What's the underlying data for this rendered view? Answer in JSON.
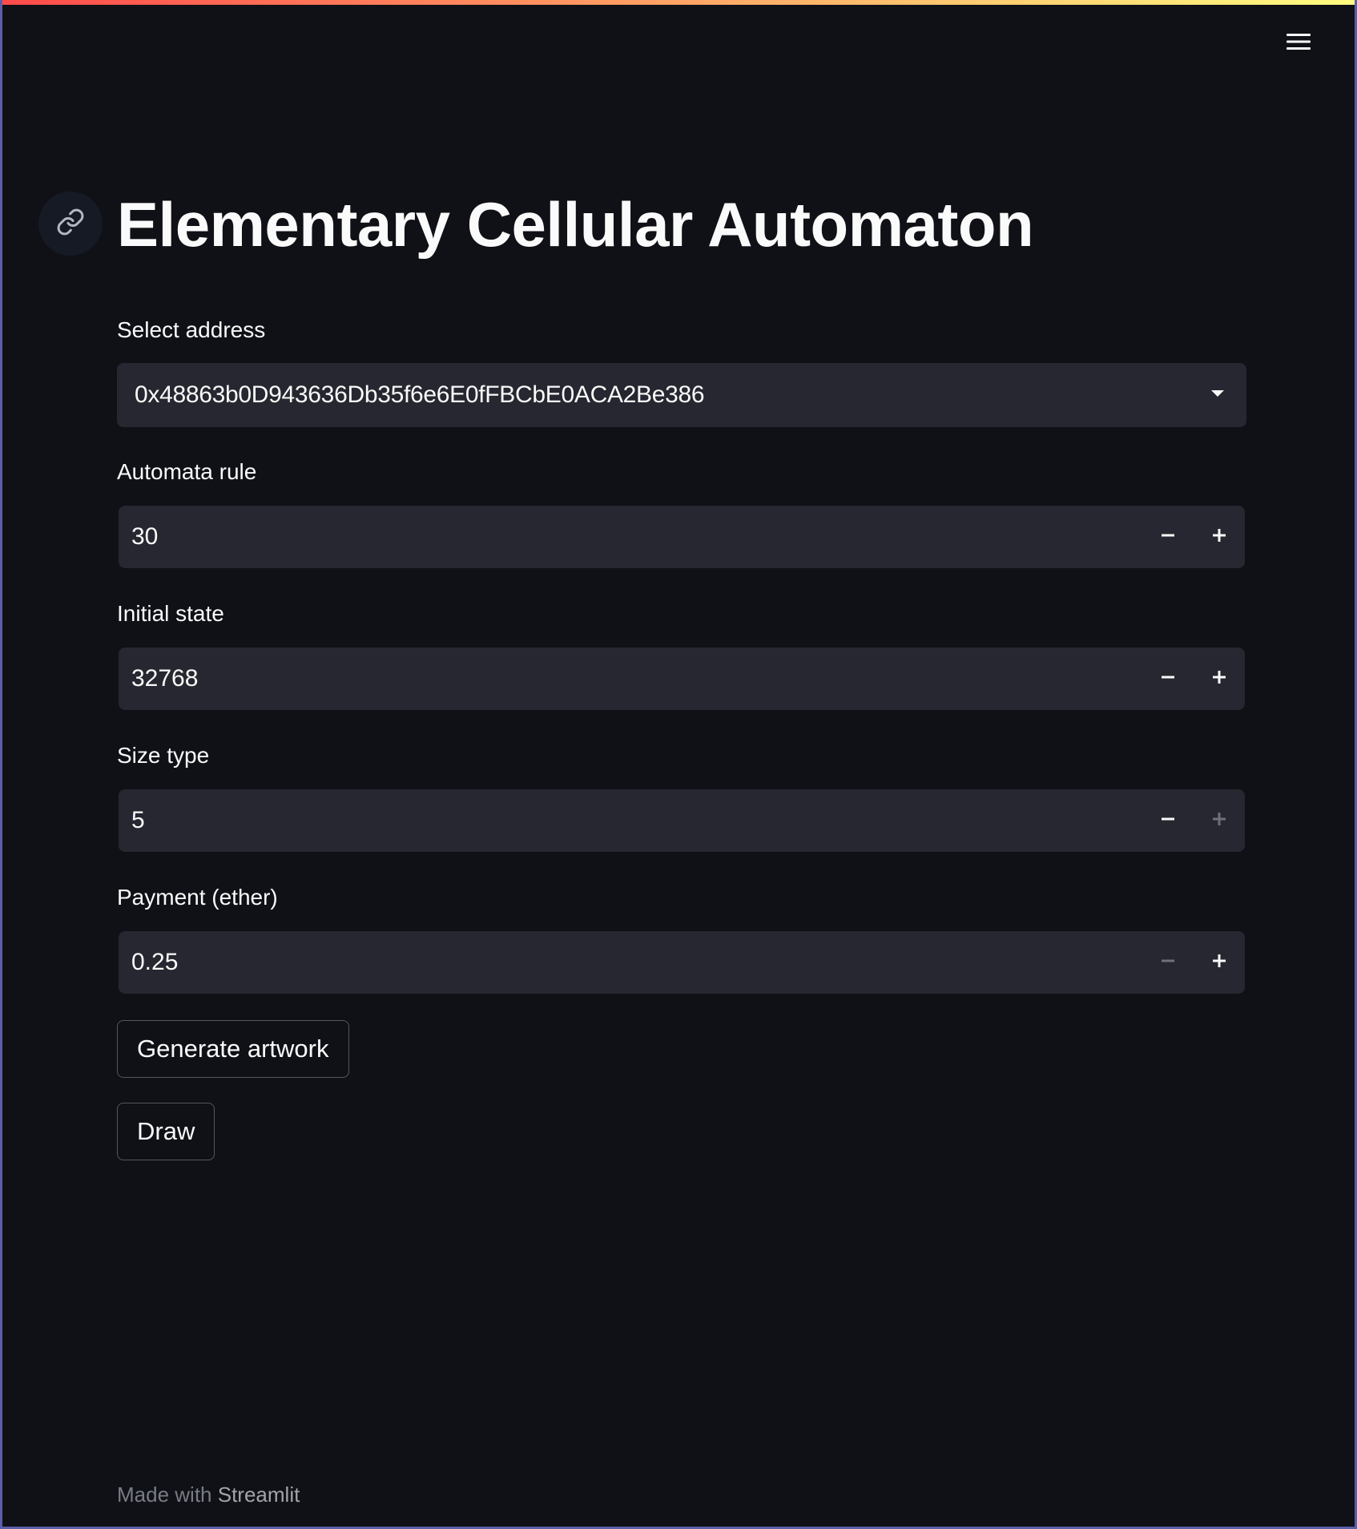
{
  "header": {
    "menu_icon": "hamburger-menu-icon",
    "accent_gradient": [
      "#ff4b4b",
      "#fffd80"
    ]
  },
  "title": {
    "text": "Elementary Cellular Automaton",
    "anchor_icon": "link-icon"
  },
  "form": {
    "address": {
      "label": "Select address",
      "value": "0x48863b0D943636Db35f6e6E0fFBCbE0ACA2Be386"
    },
    "rule": {
      "label": "Automata rule",
      "value": "30"
    },
    "initial_state": {
      "label": "Initial state",
      "value": "32768"
    },
    "size_type": {
      "label": "Size type",
      "value": "5"
    },
    "payment": {
      "label": "Payment (ether)",
      "value": "0.25"
    }
  },
  "buttons": {
    "generate": "Generate artwork",
    "draw": "Draw"
  },
  "footer": {
    "prefix": "Made with",
    "brand": "Streamlit"
  },
  "colors": {
    "background": "#0f1117",
    "input_bg": "#262730",
    "text": "#fafafa",
    "frame": "#5b5ea8"
  }
}
